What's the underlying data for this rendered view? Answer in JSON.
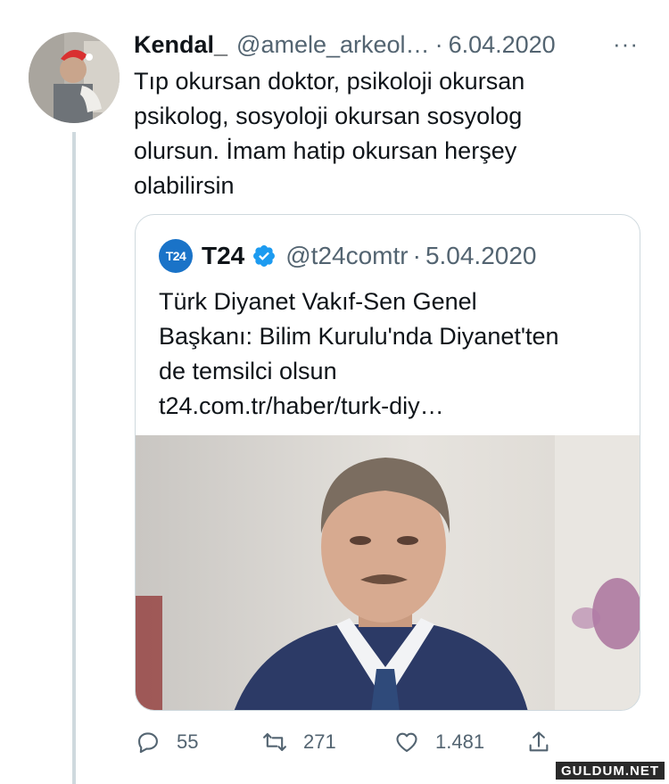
{
  "tweet": {
    "display_name": "Kendal_",
    "handle": "@amele_arkeol…",
    "separator": "·",
    "date": "6.04.2020",
    "more": "···",
    "text_lines": [
      "Tıp okursan doktor, psikoloji okursan",
      "psikolog, sosyoloji okursan sosyolog",
      "olursun. İmam hatip okursan herşey",
      "olabilirsin"
    ]
  },
  "quote": {
    "logo_text": "T24",
    "display_name": "T24",
    "verified": true,
    "handle": "@t24comtr",
    "separator": "·",
    "date": "5.04.2020",
    "text_lines": [
      "Türk Diyanet Vakıf-Sen Genel",
      "Başkanı: Bilim Kurulu'nda Diyanet'ten",
      "de temsilci olsun",
      "t24.com.tr/haber/turk-diy…"
    ]
  },
  "actions": {
    "reply_count": "55",
    "retweet_count": "271",
    "like_count": "1.481"
  },
  "watermark": "GULDUM.NET",
  "colors": {
    "text": "#0f1419",
    "secondary": "#536471",
    "border": "#cfd9de",
    "verified": "#1d9bf0",
    "t24_blue": "#1a73c8"
  }
}
